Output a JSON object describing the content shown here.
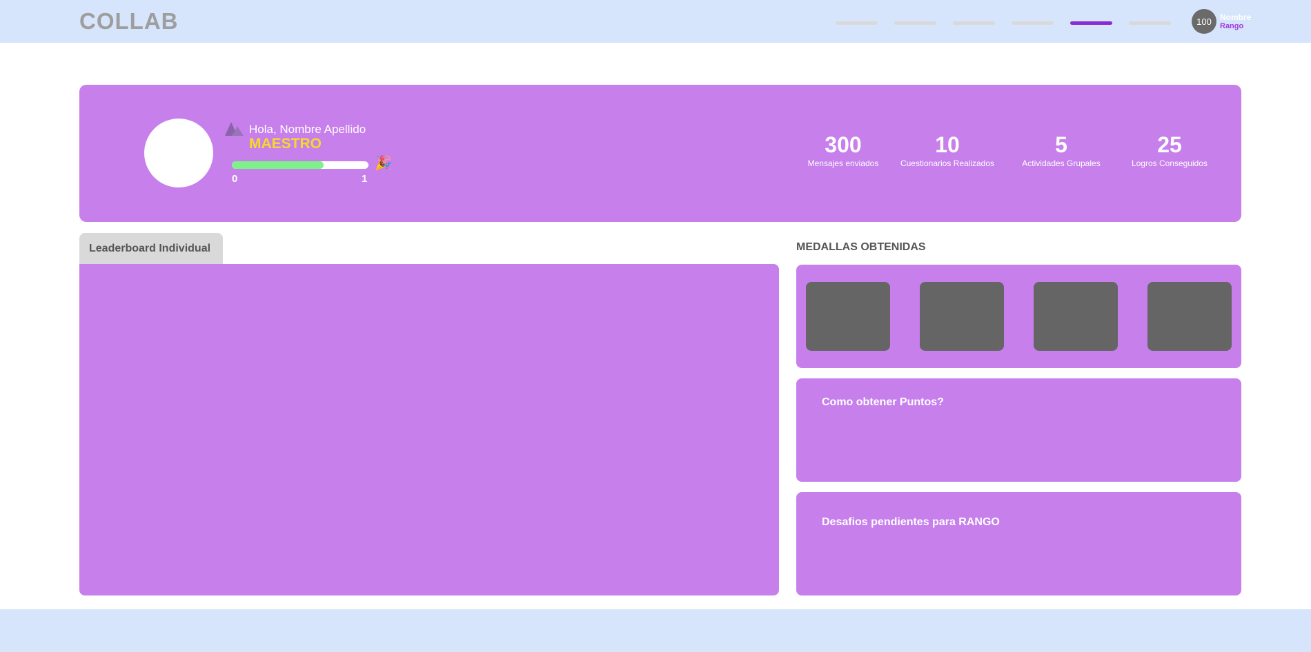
{
  "app": {
    "logo": "COLLAB"
  },
  "nav": {
    "items": [
      "",
      "",
      "",
      "",
      "",
      ""
    ],
    "active_index": 4
  },
  "user": {
    "points": "100",
    "name": "Nombre",
    "rank": "Rango"
  },
  "profile": {
    "greeting": "Hola, Nombre Apellido",
    "rank_title": "MAESTRO",
    "progress": {
      "min": "0",
      "max": "1",
      "fraction": 0.67
    }
  },
  "stats": [
    {
      "value": "300",
      "label": "Mensajes enviados"
    },
    {
      "value": "10",
      "label": "Cuestionarios Realizados"
    },
    {
      "value": "5",
      "label": "Actividades Grupales"
    },
    {
      "value": "25",
      "label": "Logros Conseguidos"
    }
  ],
  "leaderboard": {
    "tab_label": "Leaderboard Individual"
  },
  "medals": {
    "title": "MEDALLAS OBTENIDAS",
    "count": 4
  },
  "points_info": {
    "title": "Como obtener Puntos?"
  },
  "challenges": {
    "title": "Desafios pendientes para RANGO"
  },
  "colors": {
    "header_bg": "#d6e4fc",
    "panel_bg": "#c77fec",
    "accent": "#8a2ad2",
    "rank_gold": "#f6d928",
    "progress_fill": "#7ff189",
    "medal_placeholder": "#656565"
  },
  "icons": {
    "rank_icon": "mountain-icon",
    "celebrate_icon": "party-popper-icon"
  }
}
